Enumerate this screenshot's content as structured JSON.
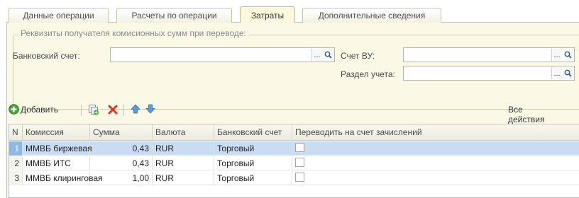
{
  "tabs": [
    {
      "label": "Данные операции"
    },
    {
      "label": "Расчеты по операции"
    },
    {
      "label": "Затраты"
    },
    {
      "label": "Дополнительные сведения"
    }
  ],
  "group": {
    "title": "Реквизиты получателя комисионных сумм при переводе:",
    "bank_account_label": "Банковский счет:",
    "bank_account_value": "",
    "vu_account_label": "Счет ВУ:",
    "vu_account_value": "",
    "section_label": "Раздел учета:",
    "section_value": "",
    "dots_label": "...",
    "search_label": "Q"
  },
  "toolbar": {
    "add_label": "Добавить",
    "all_actions_label": "Все действия ▾"
  },
  "table": {
    "columns": [
      "N",
      "Комиссия",
      "Сумма",
      "Валюта",
      "Банковский счет",
      "Переводить на счет зачислений"
    ],
    "rows": [
      {
        "n": "1",
        "commission": "ММВБ биржевая",
        "amount": "0,43",
        "currency": "RUR",
        "account": "Торговый"
      },
      {
        "n": "2",
        "commission": "ММВБ ИТС",
        "amount": "0,43",
        "currency": "RUR",
        "account": "Торговый"
      },
      {
        "n": "3",
        "commission": "ММВБ клиринговая",
        "amount": "1,00",
        "currency": "RUR",
        "account": "Торговый"
      }
    ]
  },
  "colors": {
    "panel_bg": "#fbf9e5",
    "selection": "#c9dcf2",
    "add_icon": "#4aa33a",
    "delete_icon": "#e0322a",
    "arrow_icon": "#3b7fd1"
  }
}
